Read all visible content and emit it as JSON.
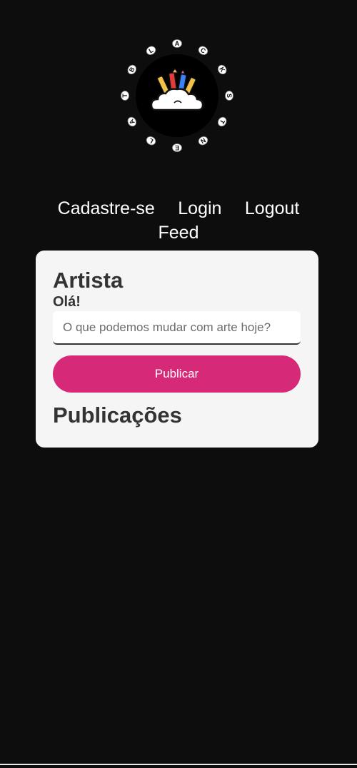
{
  "logo": {
    "letters": [
      "A",
      "C",
      "K",
      "S",
      "T",
      "N",
      "E",
      "L",
      "A",
      "T",
      "B",
      "L"
    ],
    "icon": "art-supplies-cloud-icon"
  },
  "nav": {
    "signup": "Cadastre-se",
    "login": "Login",
    "logout": "Logout",
    "feed": "Feed"
  },
  "card": {
    "title": "Artista",
    "greeting": "Olá!",
    "input_placeholder": "O que podemos mudar com arte hoje?",
    "input_value": "",
    "publish_label": "Publicar",
    "publications_title": "Publicações"
  },
  "colors": {
    "background": "#0d0d0d",
    "card": "#f5f5f5",
    "accent": "#d62a78",
    "text_dark": "#333333"
  }
}
